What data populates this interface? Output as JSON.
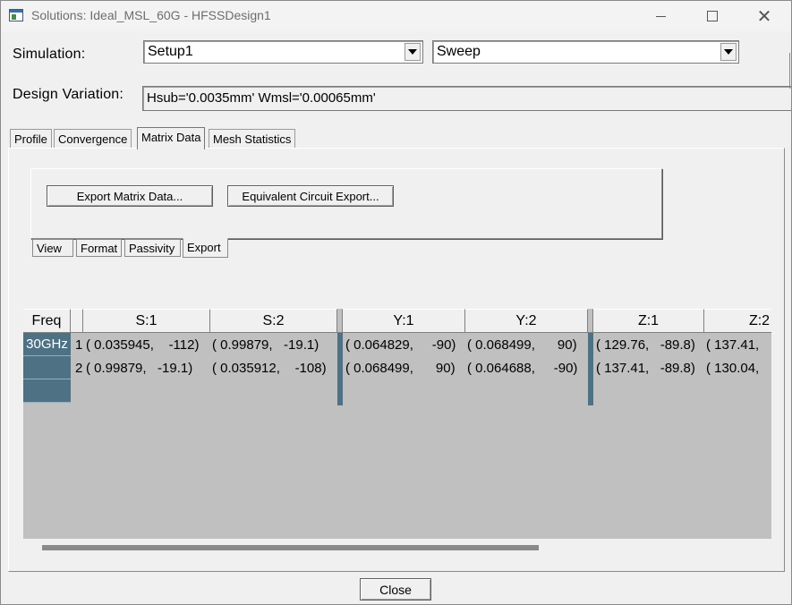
{
  "window": {
    "title": "Solutions: Ideal_MSL_60G - HFSSDesign1",
    "icons": {
      "app": "app-window-icon",
      "minimize": "minimize-icon",
      "maximize": "maximize-icon",
      "close": "close-icon",
      "close_glyph": "✕"
    }
  },
  "simulation": {
    "label": "Simulation:",
    "setup_value": "Setup1",
    "sweep_value": "Sweep"
  },
  "design_variation": {
    "label": "Design Variation:",
    "value": "Hsub='0.0035mm' Wmsl='0.00065mm'"
  },
  "tabs": [
    {
      "label": "Profile",
      "active": false
    },
    {
      "label": "Convergence",
      "active": false
    },
    {
      "label": "Matrix Data",
      "active": true
    },
    {
      "label": "Mesh Statistics",
      "active": false
    }
  ],
  "export_panel": {
    "export_matrix_button": "Export Matrix Data...",
    "equivalent_circuit_button": "Equivalent Circuit Export..."
  },
  "subtabs": [
    {
      "label": "View",
      "active": false
    },
    {
      "label": "Format",
      "active": false
    },
    {
      "label": "Passivity",
      "active": false
    },
    {
      "label": "Export",
      "active": true
    }
  ],
  "grid": {
    "headers": {
      "freq": "Freq",
      "s1": "S:1",
      "s2": "S:2",
      "y1": "Y:1",
      "y2": "Y:2",
      "z1": "Z:1",
      "z2": "Z:2"
    },
    "freq": "30GHz",
    "rows": [
      {
        "index": "1",
        "s1": "( 0.035945,    -112)",
        "s2": "( 0.99879,   -19.1)",
        "y1": "( 0.064829,     -90)",
        "y2": "( 0.068499,      90)",
        "z1": "( 129.76,   -89.8)",
        "z2": "( 137.41,"
      },
      {
        "index": "2",
        "s1": "( 0.99879,   -19.1)",
        "s2": "( 0.035912,    -108)",
        "y1": "( 0.068499,      90)",
        "y2": "( 0.064688,     -90)",
        "z1": "( 137.41,   -89.8)",
        "z2": "( 130.04,"
      }
    ],
    "colors": {
      "row_header": "#4e7183",
      "background": "#c0c0c0"
    }
  },
  "footer": {
    "close_button": "Close"
  }
}
